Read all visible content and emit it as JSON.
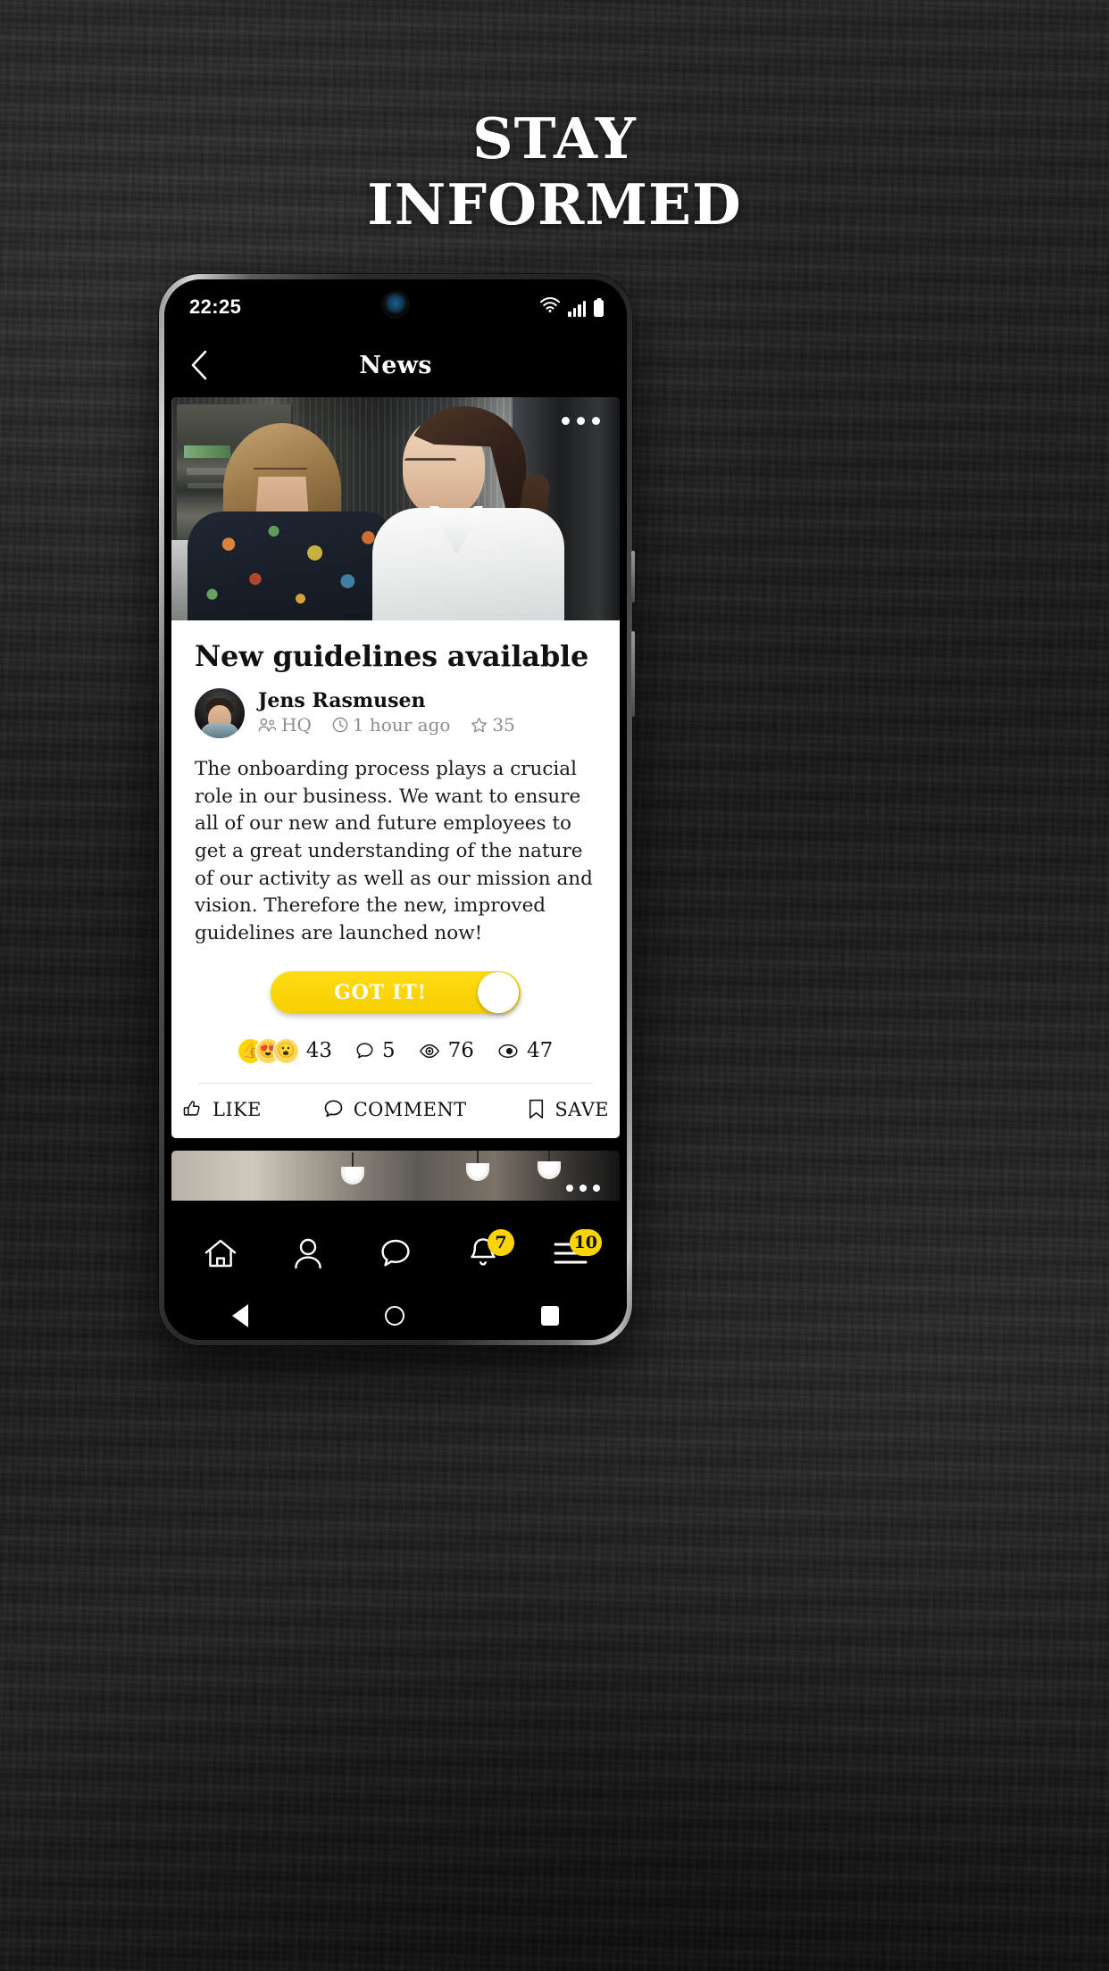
{
  "promo": {
    "headline_line1": "STAY",
    "headline_line2": "INFORMED"
  },
  "status_bar": {
    "time": "22:25",
    "wifi_icon": "wifi-icon",
    "signal_icon": "signal-bars-icon",
    "battery_icon": "battery-icon"
  },
  "app_bar": {
    "back_icon": "chevron-left-icon",
    "title": "News"
  },
  "article": {
    "hero_image_alt": "two-women-talking-in-commercial-kitchen",
    "more_icon": "more-horizontal-icon",
    "title": "New guidelines available",
    "author": {
      "name": "Jens Rasmusen",
      "avatar_alt": "jens-rasmusen-avatar"
    },
    "meta": {
      "group_icon": "people-icon",
      "group": "HQ",
      "time_icon": "clock-icon",
      "time": "1 hour ago",
      "star_icon": "star-icon",
      "star_count": "35"
    },
    "body": "The onboarding process plays a crucial role in our business. We want to ensure all of our new and future employees to get a great understanding of the nature of our activity as well as our mission and vision. Therefore the new, improved guidelines are launched now!",
    "cta": {
      "label": "GOT IT!",
      "color": "#f9d200",
      "knob": "slider-knob"
    },
    "stats": [
      {
        "name": "reactions",
        "icon": "emoji-reactions",
        "emojis": [
          "👍",
          "😍",
          "😮"
        ],
        "count": "43"
      },
      {
        "name": "comments",
        "icon": "comment-bubble-icon",
        "count": "5"
      },
      {
        "name": "views",
        "icon": "eye-icon",
        "count": "76"
      },
      {
        "name": "reads",
        "icon": "read-receipt-icon",
        "count": "47"
      }
    ],
    "actions": [
      {
        "name": "like",
        "icon": "thumbs-up-icon",
        "label": "LIKE"
      },
      {
        "name": "comment",
        "icon": "comment-bubble-icon",
        "label": "COMMENT"
      },
      {
        "name": "save",
        "icon": "bookmark-icon",
        "label": "SAVE"
      }
    ]
  },
  "next_article": {
    "hero_image_alt": "restaurant-interior-with-pendant-lamps",
    "more_icon": "more-horizontal-icon"
  },
  "bottom_nav": [
    {
      "name": "home",
      "icon": "home-icon",
      "badge": null
    },
    {
      "name": "profile",
      "icon": "person-icon",
      "badge": null
    },
    {
      "name": "chat",
      "icon": "chat-bubble-icon",
      "badge": null
    },
    {
      "name": "notifications",
      "icon": "bell-icon",
      "badge": "7"
    },
    {
      "name": "menu",
      "icon": "hamburger-menu-icon",
      "badge": "10"
    }
  ],
  "android_nav": [
    {
      "name": "back",
      "icon": "triangle-back-icon"
    },
    {
      "name": "home",
      "icon": "circle-home-icon"
    },
    {
      "name": "recents",
      "icon": "square-recents-icon"
    }
  ],
  "colors": {
    "accent_yellow": "#fbd405",
    "card_bg": "#ffffff",
    "app_bg": "#000000",
    "muted_text": "#8d8d8d"
  }
}
